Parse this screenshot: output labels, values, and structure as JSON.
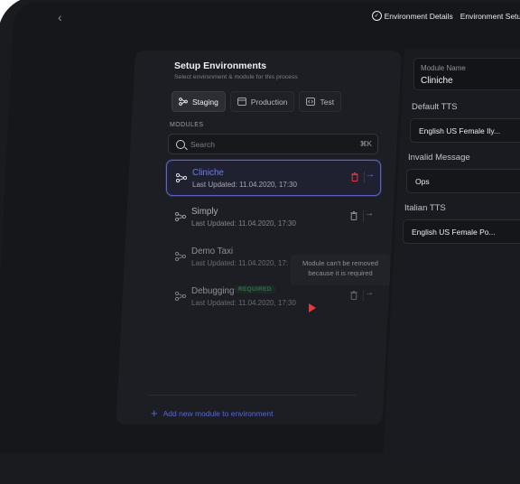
{
  "header": {
    "env_details": "Environment Details",
    "env_setup": "Environment Setup"
  },
  "panel": {
    "title": "Setup Environments",
    "subtitle": "Select environment & module for this process",
    "tabs": [
      {
        "label": "Staging",
        "active": true
      },
      {
        "label": "Production",
        "active": false
      },
      {
        "label": "Test",
        "active": false
      }
    ],
    "modules_label": "MODULES",
    "search_placeholder": "Search",
    "search_shortcut": "⌘K",
    "modules": [
      {
        "name": "Cliniche",
        "date": "Last Updated: 11.04.2020, 17:30",
        "active": true
      },
      {
        "name": "Simply",
        "date": "Last Updated: 11.04.2020, 17:30",
        "active": false
      },
      {
        "name": "Demo Taxi",
        "date": "Last Updated: 11.04.2020, 17:",
        "active": false
      },
      {
        "name": "Debugging",
        "date": "Last Updated: 11.04.2020, 17:30",
        "badge": "REQUIRED",
        "active": false
      }
    ],
    "tooltip_line1": "Module can't be removed",
    "tooltip_line2": "because it is required",
    "add_label": "Add new module to environment"
  },
  "details": {
    "module_name_label": "Module Name",
    "module_name_value": "Cliniche",
    "default_tts_label": "Default TTS",
    "default_tts_value": "English US Female Ily...",
    "invalid_message_label": "Invalid Message",
    "invalid_message_value": "Ops",
    "italian_tts_label": "Italian TTS",
    "italian_tts_value": "English US Female Po..."
  },
  "colors": {
    "accent": "#6e7cf3",
    "danger": "#e23b3b",
    "success": "#39b56a",
    "background": "#16171b"
  }
}
